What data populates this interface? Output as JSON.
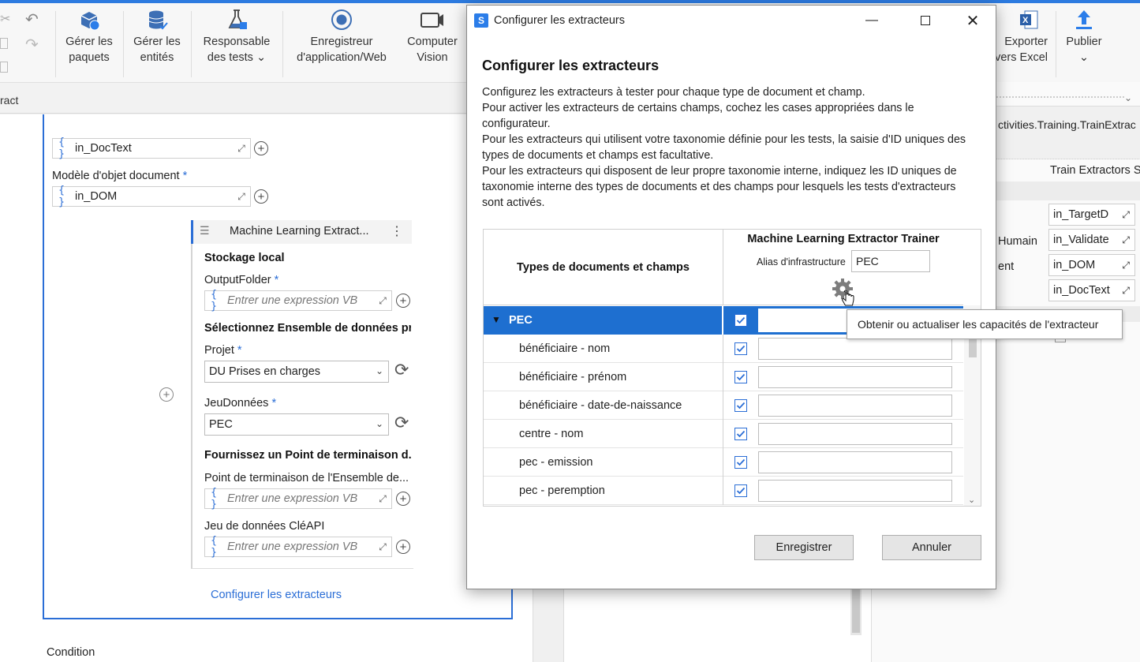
{
  "ribbon": {
    "buttons": [
      {
        "label_line1": "Gérer les",
        "label_line2": "paquets",
        "icon": "manage-packages-icon"
      },
      {
        "label_line1": "Gérer les",
        "label_line2": "entités",
        "icon": "manage-entities-icon"
      },
      {
        "label_line1": "Responsable",
        "label_line2": "des tests ⌄",
        "icon": "test-manager-flask-icon"
      },
      {
        "label_line1": "Enregistreur",
        "label_line2": "d'application/Web",
        "icon": "recorder-icon"
      },
      {
        "label_line1": "Computer",
        "label_line2": "Vision",
        "icon": "computer-vision-icon"
      },
      {
        "label_line1": "Exporter",
        "label_line2": "vers Excel",
        "icon": "excel-icon"
      },
      {
        "label_line1": "Publier",
        "label_line2": "⌄",
        "icon": "publish-icon"
      }
    ],
    "tab_label": "ract"
  },
  "designer": {
    "field1_value": "in_DocText",
    "dom_label": "Modèle d'objet document",
    "required_mark": "*",
    "dom_value": "in_DOM",
    "activity_title": "Machine Learning Extract...",
    "section_local": "Stockage local",
    "output_folder_label": "OutputFolder",
    "vb_placeholder": "Entrer une expression VB",
    "section_dataset": "Sélectionnez Ensemble de données pr",
    "project_label": "Projet",
    "project_value": "DU Prises en charges",
    "dataset_label": "JeuDonnées",
    "dataset_value": "PEC",
    "section_endpoint": "Fournissez un Point de terminaison d.",
    "endpoint_label": "Point de terminaison de l'Ensemble de...",
    "apikey_label": "Jeu de données CléAPI",
    "configure_link": "Configurer les extracteurs",
    "condition_label": "Condition"
  },
  "right_panel": {
    "header_text": "ctivities.Training.TrainExtrac",
    "col_header": "Train Extractors Sc",
    "label_humain": "Humain",
    "label_ent": "ent",
    "fields": [
      "in_TargetD",
      "in_Validate",
      "in_DOM",
      "in_DocText"
    ]
  },
  "dialog": {
    "window_title": "Configurer les extracteurs",
    "heading": "Configurer les extracteurs",
    "description": [
      "Configurez les extracteurs à tester pour chaque type de document et champ.",
      "Pour activer les extracteurs de certains champs, cochez les cases appropriées dans le configurateur.",
      "Pour les extracteurs qui utilisent votre taxonomie définie pour les tests, la saisie d'ID uniques des types de documents et champs est facultative.",
      "Pour les extracteurs qui disposent de leur propre taxonomie interne, indiquez les ID uniques de taxonomie interne des types de documents et des champs pour lesquels les tests d'extracteurs sont activés."
    ],
    "grid": {
      "left_header": "Types de documents et champs",
      "extractor_name": "Machine Learning Extractor Trainer",
      "alias_label": "Alias d'infrastructure",
      "alias_value": "PEC",
      "doc_type": "PEC",
      "fields": [
        "bénéficiaire - nom",
        "bénéficiaire - prénom",
        "bénéficiaire - date-de-naissance",
        "centre - nom",
        "pec - emission",
        "pec - peremption"
      ]
    },
    "tooltip": "Obtenir ou actualiser les capacités de l'extracteur",
    "save_label": "Enregistrer",
    "cancel_label": "Annuler"
  },
  "colors": {
    "accent": "#2b6ed6",
    "selection": "#1e6fd0"
  }
}
